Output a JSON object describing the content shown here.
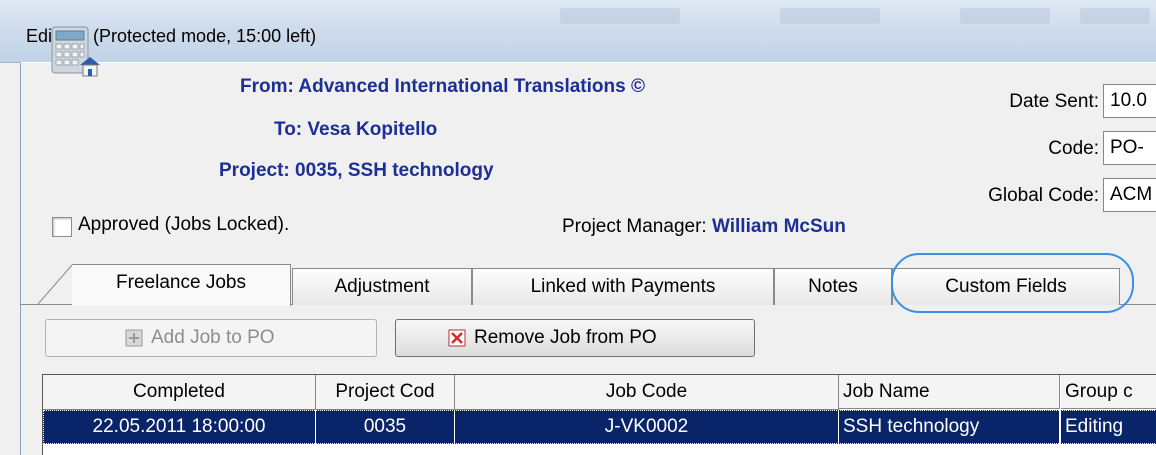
{
  "window": {
    "title": "Edit PO (Protected mode, 15:00 left)"
  },
  "header": {
    "from": "From: Advanced International Translations ©",
    "to": "To: Vesa Kopitello",
    "project": "Project: 0035, SSH technology"
  },
  "fields": {
    "date_sent_label": "Date Sent:",
    "date_sent_value": "10.0",
    "code_label": "Code:",
    "code_value": "PO-",
    "global_code_label": "Global Code:",
    "global_code_value": "ACM"
  },
  "approved": {
    "label": "Approved (Jobs Locked).",
    "checked": false
  },
  "project_manager": {
    "label": "Project Manager:",
    "name": "William McSun"
  },
  "tabs": [
    {
      "label": "Freelance Jobs",
      "active": true
    },
    {
      "label": "Adjustment"
    },
    {
      "label": "Linked with Payments"
    },
    {
      "label": "Notes"
    },
    {
      "label": "Custom Fields",
      "highlighted": true
    }
  ],
  "toolbar": {
    "add_job_label": "Add Job to PO",
    "remove_job_label": "Remove Job from PO"
  },
  "grid": {
    "columns": [
      "Completed",
      "Project Cod",
      "Job Code",
      "Job Name",
      "Group c"
    ],
    "rows": [
      [
        "22.05.2011 18:00:00",
        "0035",
        "J-VK0002",
        "SSH technology",
        "Editing"
      ]
    ]
  },
  "colors": {
    "accent_text": "#1b2f94",
    "selection": "#0a246a",
    "highlight_ring": "#3a8fe3"
  }
}
